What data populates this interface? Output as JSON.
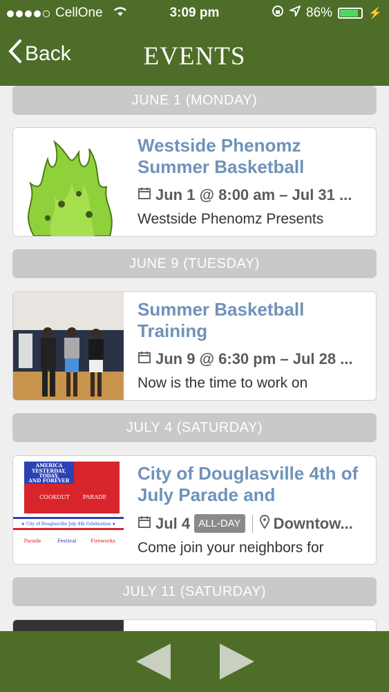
{
  "status": {
    "carrier": "CellOne",
    "time": "3:09 pm",
    "battery": "86%"
  },
  "nav": {
    "back_label": "Back",
    "title": "EVENTS"
  },
  "sections": [
    {
      "date": "JUNE 1 (MONDAY)",
      "title_line1": "Westside Phenomz",
      "title_line2": "Summer Basketball",
      "when": "Jun 1 @ 8:00 am – Jul 31 ...",
      "desc": "Westside Phenomz Presents"
    },
    {
      "date": "JUNE 9 (TUESDAY)",
      "title_line1": "Summer Basketball",
      "title_line2": "Training",
      "when": "Jun 9 @ 6:30 pm – Jul 28 ...",
      "desc": "Now is the time to work on"
    },
    {
      "date": "JULY 4 (SATURDAY)",
      "title_line1": "City of Douglasville 4th of",
      "title_line2": "July Parade and",
      "when": "Jul 4",
      "badge": "ALL-DAY",
      "location": "Downtow...",
      "desc": "Come join your neighbors for"
    },
    {
      "date": "JULY 11 (SATURDAY)"
    }
  ],
  "poster": {
    "line1": "AMERICA",
    "line2": "YESTERDAY,",
    "line3": "TODAY,",
    "line4": "AND FOREVER",
    "l5": "COOKOUT",
    "l6": "PARADE",
    "banner": "★ City of Douglasville July 4th Celebration ★",
    "footer_left": "Parade",
    "footer_mid": "Festival",
    "footer_right": "Fireworks"
  }
}
